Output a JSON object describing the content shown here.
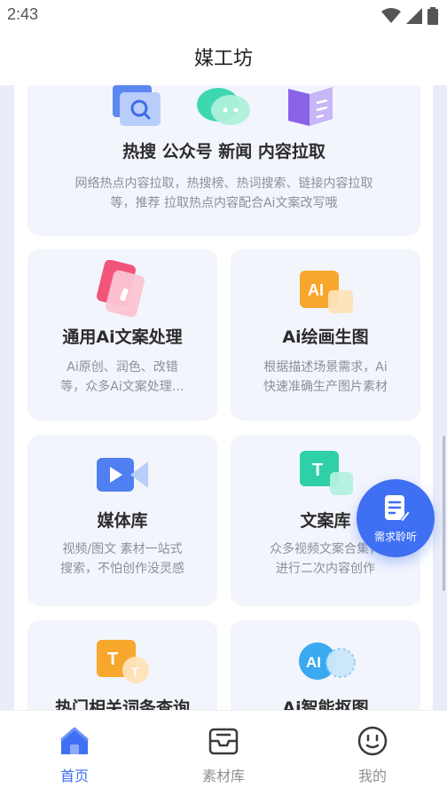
{
  "status_bar": {
    "time": "2:43"
  },
  "header": {
    "title": "媒工坊"
  },
  "cards": {
    "hot_search": {
      "title": "热搜 公众号 新闻 内容拉取",
      "desc_line1": "网络热点内容拉取，热搜榜、热词搜索、链接内容拉取",
      "desc_line2": "等，推荐 拉取热点内容配合Ai文案改写哦"
    },
    "ai_copy": {
      "title": "通用Ai文案处理",
      "desc_line1": "Ai原创、润色、改错",
      "desc_line2": "等，众多Ai文案处理…"
    },
    "ai_image": {
      "title": "Ai绘画生图",
      "desc_line1": "根据描述场景需求，Ai",
      "desc_line2": "快速准确生产图片素材"
    },
    "media_lib": {
      "title": "媒体库",
      "desc_line1": "视频/图文 素材一站式",
      "desc_line2": "搜索，不怕创作没灵感"
    },
    "copy_lib": {
      "title": "文案库",
      "desc_line1": "众多视频文案合集，",
      "desc_line2": "进行二次内容创作"
    },
    "hot_words": {
      "title": "热门相关词条查询"
    },
    "ai_matting": {
      "title": "Ai智能抠图"
    }
  },
  "icons": {
    "ai_image_glyph": "AI",
    "copy_lib_glyph": "T",
    "hot_words_glyph_1": "T",
    "hot_words_glyph_2": "T",
    "ai_matting_glyph": "AI"
  },
  "fab": {
    "label": "需求聆听"
  },
  "bottom_nav": {
    "items": [
      {
        "label": "首页",
        "active": true
      },
      {
        "label": "素材库",
        "active": false
      },
      {
        "label": "我的",
        "active": false
      }
    ]
  },
  "colors": {
    "accent": "#3f6ff2",
    "card_bg": "#f3f5fd",
    "page_bg": "#e9ecf9"
  }
}
